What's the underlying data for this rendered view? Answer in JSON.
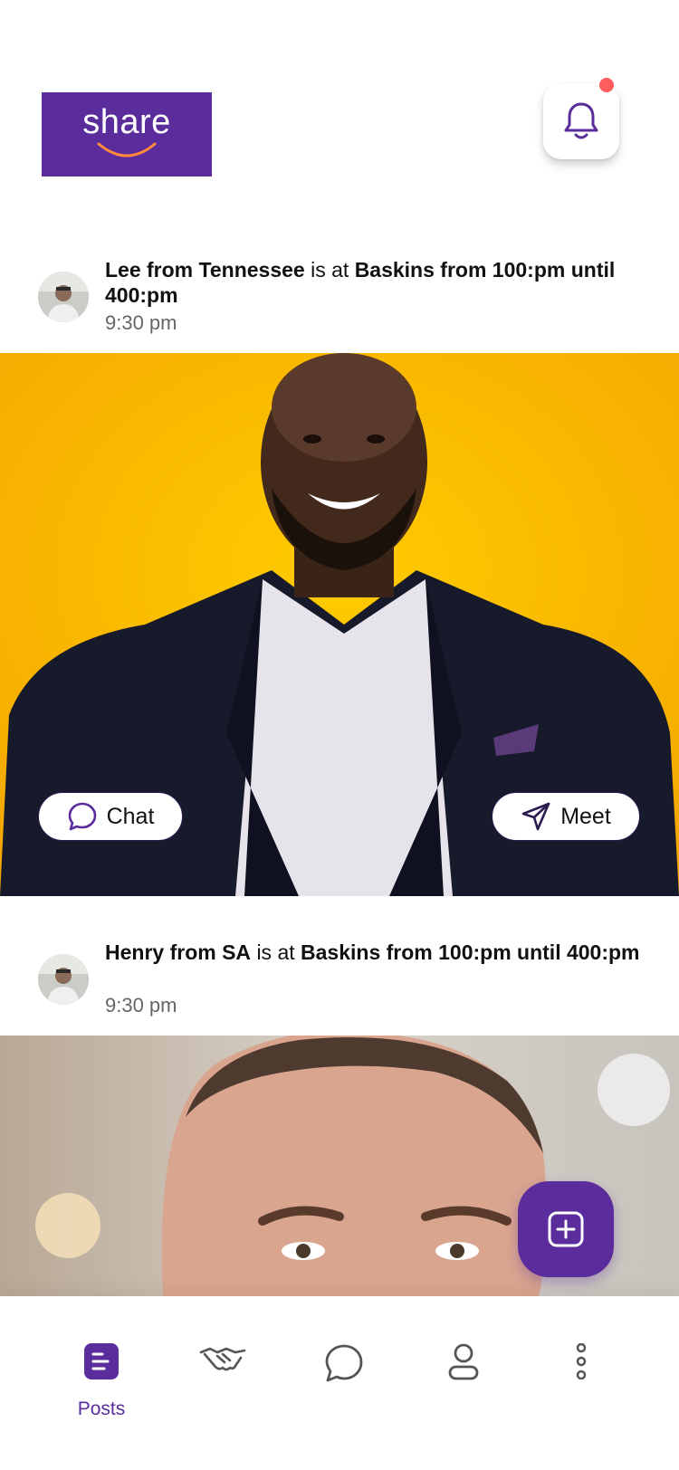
{
  "header": {
    "logo_text": "share",
    "notification_badge": true
  },
  "posts": [
    {
      "name": "Lee from Tennessee",
      "connector": "is at",
      "place_time": "Baskins from 100:pm until 400:pm",
      "time": "9:30 pm",
      "actions": {
        "chat_label": "Chat",
        "meet_label": "Meet"
      }
    },
    {
      "name": "Henry from SA",
      "connector": "is at",
      "place_time": "Baskins from 100:pm until 400:pm",
      "time": "9:30 pm"
    }
  ],
  "fab": {
    "icon": "plus-square-icon"
  },
  "bottom_nav": {
    "items": [
      {
        "id": "posts",
        "label": "Posts",
        "icon": "posts-icon",
        "active": true
      },
      {
        "id": "meet",
        "icon": "handshake-icon",
        "active": false
      },
      {
        "id": "chat",
        "icon": "chat-bubble-icon",
        "active": false
      },
      {
        "id": "profile",
        "icon": "profile-icon",
        "active": false
      },
      {
        "id": "more",
        "icon": "more-vertical-icon",
        "active": false
      }
    ]
  },
  "colors": {
    "brand": "#5b2d9c",
    "badge": "#ff5c5c",
    "photo_bg_1": "#ffb800",
    "text_muted": "#666666"
  }
}
